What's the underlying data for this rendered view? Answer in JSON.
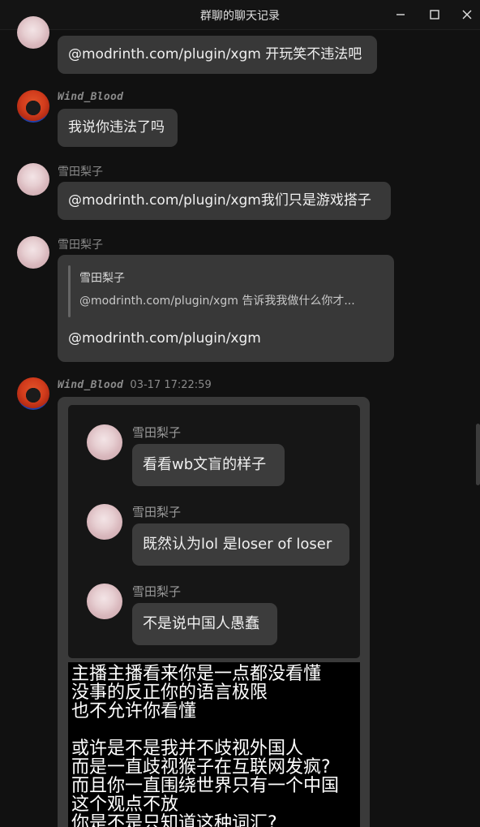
{
  "window": {
    "title": "群聊的聊天记录"
  },
  "messages": [
    {
      "sender": "",
      "text": "@modrinth.com/plugin/xgm 开玩笑不违法吧"
    },
    {
      "sender": "Wind_Blood",
      "text": "我说你违法了吗"
    },
    {
      "sender": "雪田梨子",
      "text": "@modrinth.com/plugin/xgm我们只是游戏搭子"
    },
    {
      "sender": "雪田梨子",
      "quote_name": "雪田梨子",
      "quote_text": "@modrinth.com/plugin/xgm 告诉我我做什么你才...",
      "text": "@modrinth.com/plugin/xgm"
    },
    {
      "sender": "Wind_Blood",
      "time": "03-17 17:22:59"
    }
  ],
  "forwarded": [
    {
      "sender": "雪田梨子",
      "text": "看看wb文盲的样子"
    },
    {
      "sender": "雪田梨子",
      "text": "既然认为lol 是loser of loser"
    },
    {
      "sender": "雪田梨子",
      "text": "不是说中国人愚蠢"
    }
  ],
  "image_text": [
    "主播主播看来你是一点都没看懂",
    "没事的反正你的语言极限",
    "也不允许你看懂",
    "",
    "或许是不是我并不歧视外国人",
    "而是一直歧视猴子在互联网发疯?",
    "而且你一直围绕世界只有一个中国",
    "这个观点不放",
    "你是不是只知道这种词汇?"
  ]
}
